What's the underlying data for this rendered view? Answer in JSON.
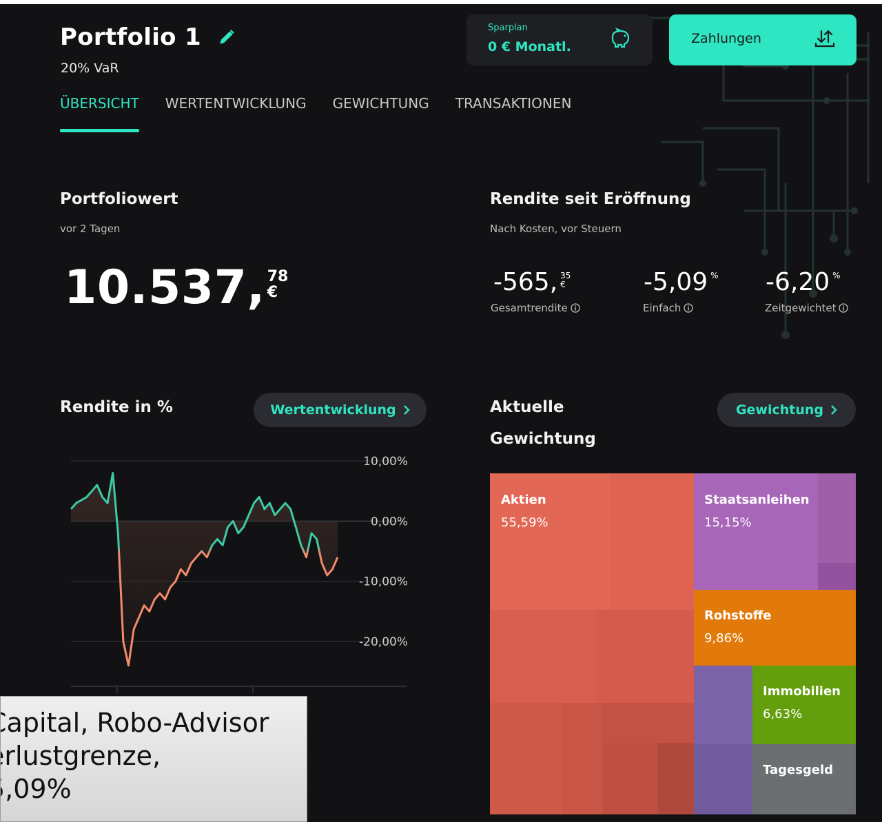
{
  "header": {
    "title": "Portfolio 1",
    "risk": "20% VaR",
    "sparplan_label": "Sparplan",
    "sparplan_value": "0 € Monatl.",
    "payments_label": "Zahlungen"
  },
  "tabs": [
    {
      "label": "ÜBERSICHT",
      "active": true
    },
    {
      "label": "WERTENTWICKLUNG",
      "active": false
    },
    {
      "label": "GEWICHTUNG",
      "active": false
    },
    {
      "label": "TRANSAKTIONEN",
      "active": false
    }
  ],
  "portfolio_value": {
    "heading": "Portfoliowert",
    "subtitle": "vor 2 Tagen",
    "integer": "10.537,",
    "cents": "78",
    "currency": "€"
  },
  "returns": {
    "heading": "Rendite seit Eröffnung",
    "subtitle": "Nach Kosten, vor Steuern",
    "total": {
      "value": "-565,",
      "cents": "35",
      "unit": "€",
      "label": "Gesamtrendite"
    },
    "simple": {
      "value": "-5,09",
      "unit": "%",
      "label": "Einfach"
    },
    "time_weighted": {
      "value": "-6,20",
      "unit": "%",
      "label": "Zeitgewichtet"
    }
  },
  "performance": {
    "heading": "Rendite in %",
    "button_label": "Wertentwicklung"
  },
  "allocation": {
    "heading_line1": "Aktuelle",
    "heading_line2": "Gewichtung",
    "button_label": "Gewichtung"
  },
  "chart_data": {
    "type": "line",
    "title": "Rendite in %",
    "ylim": [
      -25,
      10
    ],
    "y_ticks": [
      "10,00%",
      "0,00%",
      "-10,00%",
      "-20,00%"
    ],
    "y_tick_values": [
      10,
      0,
      -10,
      -20
    ],
    "series": [
      {
        "values": [
          2,
          3,
          3.5,
          4,
          5,
          6,
          4,
          3,
          8,
          -2,
          -20,
          -24,
          -18,
          -16,
          -14,
          -15,
          -13,
          -12,
          -13,
          -11,
          -10,
          -8,
          -9,
          -7,
          -6,
          -5,
          -6,
          -4,
          -3,
          -4,
          -1,
          0,
          -2,
          -1,
          1,
          3,
          4,
          2,
          3,
          1,
          2,
          3,
          2,
          -1,
          -4,
          -6,
          -2,
          -3,
          -7,
          -9,
          -8,
          -6
        ]
      }
    ],
    "colors": {
      "positive": "#3dc9a4",
      "negative": "#f28a6b"
    }
  },
  "treemap": {
    "items": [
      {
        "name": "Aktien",
        "value": "55,59%",
        "color": "#dc6150"
      },
      {
        "name": "Staatsanleihen",
        "value": "15,15%",
        "color": "#a766b8"
      },
      {
        "name": "Rohstoffe",
        "value": "9,86%",
        "color": "#e27a0b"
      },
      {
        "name": "Immobilien",
        "value": "6,63%",
        "color": "#639f0c"
      },
      {
        "name": "Tagesgeld",
        "value": "",
        "color": "#6c6f72"
      }
    ]
  },
  "caption": {
    "line1": "Capital, Robo-Advisor",
    "line2": "erlustgrenze,",
    "line3": "5,09%"
  },
  "colors": {
    "accent": "#2ee6c2",
    "background": "#121214",
    "panel": "#1e1f23"
  }
}
